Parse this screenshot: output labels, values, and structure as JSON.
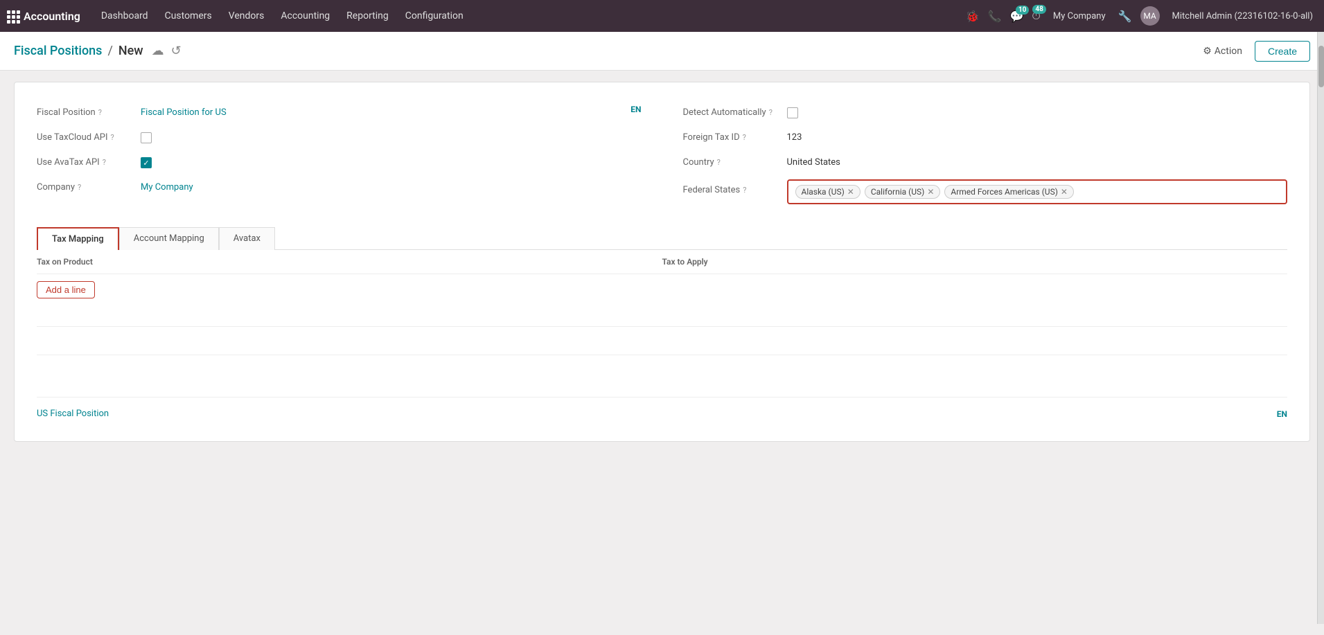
{
  "topnav": {
    "app_name": "Accounting",
    "menu_items": [
      "Dashboard",
      "Customers",
      "Vendors",
      "Accounting",
      "Reporting",
      "Configuration"
    ],
    "company": "My Company",
    "notifications_count": "10",
    "clock_count": "48",
    "user": "Mitchell Admin (22316102-16-0-all)"
  },
  "breadcrumb": {
    "link": "Fiscal Positions",
    "separator": "/",
    "current": "New",
    "action_label": "Action",
    "create_label": "Create"
  },
  "form": {
    "fiscal_position_label": "Fiscal Position",
    "fiscal_position_value": "Fiscal Position for US",
    "lang": "EN",
    "detect_auto_label": "Detect Automatically",
    "use_taxcloud_label": "Use TaxCloud API",
    "foreign_tax_id_label": "Foreign Tax ID",
    "foreign_tax_id_value": "123",
    "use_avatax_label": "Use AvaTax API",
    "country_label": "Country",
    "country_value": "United States",
    "company_label": "Company",
    "company_value": "My Company",
    "federal_states_label": "Federal States",
    "federal_states": [
      "Alaska (US)",
      "California (US)",
      "Armed Forces Americas (US)"
    ]
  },
  "tabs": [
    {
      "label": "Tax Mapping",
      "active": true
    },
    {
      "label": "Account Mapping",
      "active": false
    },
    {
      "label": "Avatax",
      "active": false
    }
  ],
  "table": {
    "col1": "Tax on Product",
    "col2": "Tax to Apply",
    "add_line": "Add a line"
  },
  "footer": {
    "label": "US Fiscal Position",
    "lang": "EN"
  }
}
